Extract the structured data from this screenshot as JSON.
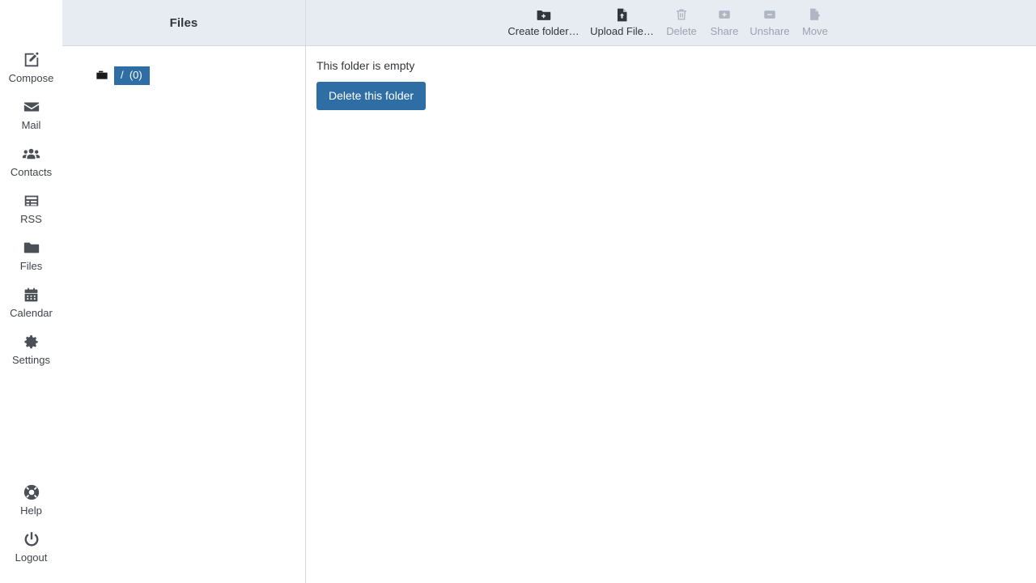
{
  "colors": {
    "accent": "#2f6ea5",
    "header_bg": "#e7ebf2",
    "border": "#d3d9e3",
    "icon": "#4b4f56",
    "disabled_text": "#9aa3b0"
  },
  "sidebar": {
    "top_items": [
      {
        "label": "Compose",
        "icon": "compose-icon"
      },
      {
        "label": "Mail",
        "icon": "envelope-icon"
      },
      {
        "label": "Contacts",
        "icon": "people-icon"
      },
      {
        "label": "RSS",
        "icon": "rss-list-icon"
      },
      {
        "label": "Files",
        "icon": "folder-icon"
      },
      {
        "label": "Calendar",
        "icon": "calendar-icon"
      },
      {
        "label": "Settings",
        "icon": "gear-icon"
      }
    ],
    "bottom_items": [
      {
        "label": "Help",
        "icon": "lifebuoy-icon"
      },
      {
        "label": "Logout",
        "icon": "power-icon"
      }
    ]
  },
  "list_panel": {
    "title": "Files",
    "folders": [
      {
        "label": "/  (0)",
        "selected": true
      }
    ]
  },
  "toolbar": {
    "buttons": [
      {
        "label": "Create folder…",
        "icon": "folder-plus-icon",
        "enabled": true
      },
      {
        "label": "Upload File…",
        "icon": "file-upload-icon",
        "enabled": true
      },
      {
        "label": "Delete",
        "icon": "trash-icon",
        "enabled": false
      },
      {
        "label": "Share",
        "icon": "square-plus-icon",
        "enabled": false
      },
      {
        "label": "Unshare",
        "icon": "square-minus-icon",
        "enabled": false
      },
      {
        "label": "Move",
        "icon": "file-move-icon",
        "enabled": false
      }
    ]
  },
  "main": {
    "empty_message": "This folder is empty",
    "delete_button": "Delete this folder"
  }
}
